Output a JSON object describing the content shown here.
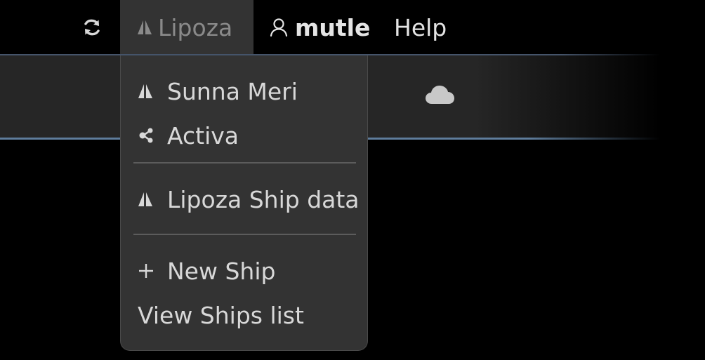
{
  "topbar": {
    "refresh_icon": "refresh-icon",
    "ship_menu": {
      "icon": "ship-triangle-icon",
      "label": "Lipoza"
    },
    "user_menu": {
      "icon": "user-icon",
      "label": "mutle"
    },
    "help_label": "Help"
  },
  "band": {
    "cloud_icon": "cloud-icon"
  },
  "dropdown": {
    "ships": [
      {
        "icon": "ship-triangle-icon",
        "label": "Sunna Meri"
      },
      {
        "icon": "network-icon",
        "label": "Activa"
      }
    ],
    "ship_data": {
      "icon": "ship-triangle-icon",
      "label": "Lipoza Ship data"
    },
    "new_ship": {
      "icon": "plus-icon",
      "label": "New Ship"
    },
    "view_list": {
      "label": "View Ships list"
    }
  },
  "colors": {
    "menu_bg": "#333333",
    "band_bg": "#262626",
    "accent_line": "#5f7d9c",
    "text": "#d8d8d8"
  }
}
